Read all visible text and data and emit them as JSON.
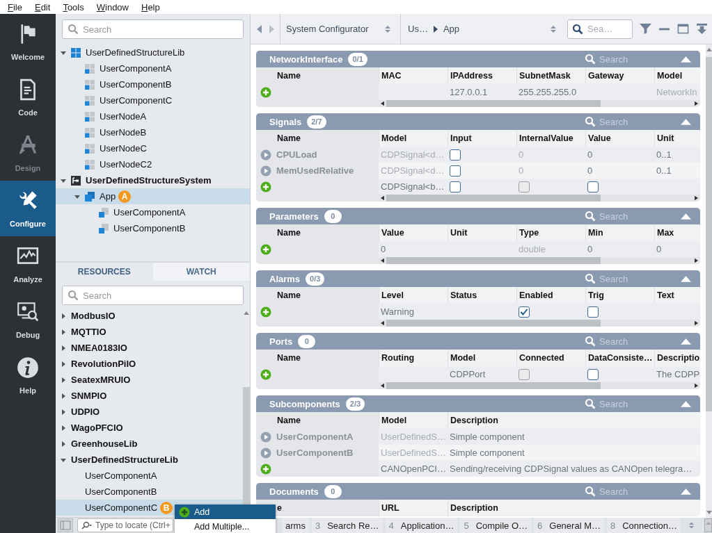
{
  "menu": [
    "File",
    "Edit",
    "Tools",
    "Window",
    "Help"
  ],
  "nav": [
    {
      "label": "Welcome",
      "selected": false,
      "disabled": false
    },
    {
      "label": "Code",
      "selected": false,
      "disabled": false
    },
    {
      "label": "Design",
      "selected": false,
      "disabled": true
    },
    {
      "label": "Configure",
      "selected": true,
      "disabled": false
    },
    {
      "label": "Analyze",
      "selected": false,
      "disabled": false
    },
    {
      "label": "Debug",
      "selected": false,
      "disabled": false
    },
    {
      "label": "Help",
      "selected": false,
      "disabled": false
    }
  ],
  "tree_search": {
    "placeholder": "Search"
  },
  "tree": [
    {
      "label": "UserDefinedStructureLib",
      "kind": "library",
      "expanded": true,
      "selected": false,
      "children": [
        {
          "label": "UserComponentA",
          "kind": "component",
          "selected": false
        },
        {
          "label": "UserComponentB",
          "kind": "component",
          "selected": false
        },
        {
          "label": "UserComponentC",
          "kind": "component",
          "selected": false
        },
        {
          "label": "UserNodeA",
          "kind": "component",
          "selected": false
        },
        {
          "label": "UserNodeB",
          "kind": "component",
          "selected": false
        },
        {
          "label": "UserNodeC",
          "kind": "component",
          "selected": false
        },
        {
          "label": "UserNodeC2",
          "kind": "component",
          "selected": false
        }
      ]
    },
    {
      "label": "UserDefinedStructureSystem",
      "kind": "system",
      "expanded": true,
      "selected": false,
      "children": [
        {
          "label": "App",
          "kind": "app",
          "expanded": true,
          "selected": true,
          "badge": "A",
          "children": [
            {
              "label": "UserComponentA",
              "kind": "instance",
              "selected": false
            },
            {
              "label": "UserComponentB",
              "kind": "instance",
              "selected": false
            }
          ]
        }
      ]
    }
  ],
  "resources_panel": {
    "tabs": [
      {
        "label": "RESOURCES",
        "selected": true
      },
      {
        "label": "WATCH",
        "selected": false
      }
    ],
    "search": {
      "placeholder": "Search"
    },
    "items": [
      {
        "label": "ModbusIO",
        "expanded": false,
        "selected": false
      },
      {
        "label": "MQTTIO",
        "expanded": false,
        "selected": false
      },
      {
        "label": "NMEA0183IO",
        "expanded": false,
        "selected": false
      },
      {
        "label": "RevolutionPiIO",
        "expanded": false,
        "selected": false
      },
      {
        "label": "SeatexMRUIO",
        "expanded": false,
        "selected": false
      },
      {
        "label": "SNMPIO",
        "expanded": false,
        "selected": false
      },
      {
        "label": "UDPIO",
        "expanded": false,
        "selected": false
      },
      {
        "label": "WagoPFCIO",
        "expanded": false,
        "selected": false
      },
      {
        "label": "GreenhouseLib",
        "expanded": false,
        "selected": false
      },
      {
        "label": "UserDefinedStructureLib",
        "expanded": true,
        "selected": false,
        "children": [
          {
            "label": "UserComponentA",
            "selected": false
          },
          {
            "label": "UserComponentB",
            "selected": false
          },
          {
            "label": "UserComponentC",
            "selected": true,
            "badge": "B"
          }
        ]
      }
    ],
    "locate": {
      "placeholder": "Type to locate (Ctrl+"
    }
  },
  "toolbar": {
    "configurator": "System Configurator",
    "breadcrumb": [
      "Us…",
      "App"
    ],
    "search": {
      "placeholder": "Sea…"
    }
  },
  "sections": [
    {
      "title": "NetworkInterface",
      "count": "0/1",
      "search": {
        "placeholder": "Search"
      },
      "columns": [
        "Name",
        "MAC",
        "IPAddress",
        "SubnetMask",
        "Gateway",
        "Model"
      ],
      "rows": [
        {
          "cells": [
            {
              "kind": "add"
            },
            "",
            {
              "kind": "text",
              "text": "127.0.0.1",
              "dim": false
            },
            {
              "kind": "text",
              "text": "255.255.255.0",
              "dim": false
            },
            "",
            {
              "kind": "text",
              "text": "NetworkIn",
              "dim": true
            }
          ]
        }
      ]
    },
    {
      "title": "Signals",
      "count": "2/7",
      "search": {
        "placeholder": "Search"
      },
      "columns": [
        "Name",
        "Model",
        "Input",
        "InternalValue",
        "Value",
        "Unit"
      ],
      "rows": [
        {
          "cells": [
            {
              "kind": "item",
              "text": "CPULoad"
            },
            {
              "kind": "text",
              "text": "CDPSignal<d…",
              "dim": true
            },
            {
              "kind": "checkbox",
              "checked": false,
              "disabled": false
            },
            {
              "kind": "text",
              "text": "0",
              "dim": true
            },
            {
              "kind": "text",
              "text": "0",
              "dim": false
            },
            {
              "kind": "text",
              "text": "0..1",
              "dim": false
            }
          ]
        },
        {
          "cells": [
            {
              "kind": "item",
              "text": "MemUsedRelative"
            },
            {
              "kind": "text",
              "text": "CDPSignal<d…",
              "dim": true
            },
            {
              "kind": "checkbox",
              "checked": false,
              "disabled": false
            },
            {
              "kind": "text",
              "text": "0",
              "dim": true
            },
            {
              "kind": "text",
              "text": "0",
              "dim": false
            },
            {
              "kind": "text",
              "text": "0..1",
              "dim": false
            }
          ]
        },
        {
          "cells": [
            {
              "kind": "add"
            },
            {
              "kind": "text",
              "text": "CDPSignal<b…",
              "dim": false
            },
            {
              "kind": "checkbox",
              "checked": false,
              "disabled": false
            },
            {
              "kind": "checkbox",
              "checked": false,
              "disabled": true
            },
            {
              "kind": "checkbox",
              "checked": false,
              "disabled": false
            },
            ""
          ]
        }
      ]
    },
    {
      "title": "Parameters",
      "count": "0",
      "search": {
        "placeholder": "Search"
      },
      "columns": [
        "Name",
        "Value",
        "Unit",
        "Type",
        "Min",
        "Max"
      ],
      "rows": [
        {
          "cells": [
            {
              "kind": "add"
            },
            {
              "kind": "text",
              "text": "0",
              "dim": false
            },
            "",
            {
              "kind": "text",
              "text": "double",
              "dim": true
            },
            {
              "kind": "text",
              "text": "0",
              "dim": false
            },
            {
              "kind": "text",
              "text": "0",
              "dim": false
            }
          ]
        }
      ]
    },
    {
      "title": "Alarms",
      "count": "0/3",
      "search": {
        "placeholder": "Search"
      },
      "columns": [
        "Name",
        "Level",
        "Status",
        "Enabled",
        "Trig",
        "Text"
      ],
      "rows": [
        {
          "cells": [
            {
              "kind": "add"
            },
            {
              "kind": "text",
              "text": "Warning",
              "dim": false
            },
            "",
            {
              "kind": "checkbox",
              "checked": true,
              "disabled": false
            },
            {
              "kind": "checkbox",
              "checked": false,
              "disabled": false
            },
            ""
          ]
        }
      ]
    },
    {
      "title": "Ports",
      "count": "0",
      "search": {
        "placeholder": "Search"
      },
      "columns": [
        "Name",
        "Routing",
        "Model",
        "Connected",
        "DataConsiste…",
        "Descriptio"
      ],
      "rows": [
        {
          "cells": [
            {
              "kind": "add"
            },
            "",
            {
              "kind": "text",
              "text": "CDPPort",
              "dim": false
            },
            {
              "kind": "checkbox",
              "checked": false,
              "disabled": true
            },
            {
              "kind": "checkbox",
              "checked": false,
              "disabled": false
            },
            {
              "kind": "text",
              "text": "The CDPP",
              "dim": false
            }
          ]
        }
      ]
    },
    {
      "title": "Subcomponents",
      "count": "2/3",
      "search": {
        "placeholder": "Search"
      },
      "columns": [
        "Name",
        "Model",
        "Description"
      ],
      "rows": [
        {
          "cells": [
            {
              "kind": "item",
              "text": "UserComponentA"
            },
            {
              "kind": "text",
              "text": "UserDefinedS…",
              "dim": true
            },
            {
              "kind": "text",
              "text": "Simple component",
              "dim": false
            }
          ]
        },
        {
          "cells": [
            {
              "kind": "item",
              "text": "UserComponentB"
            },
            {
              "kind": "text",
              "text": "UserDefinedS…",
              "dim": true
            },
            {
              "kind": "text",
              "text": "Simple component",
              "dim": false
            }
          ]
        },
        {
          "cells": [
            {
              "kind": "add"
            },
            {
              "kind": "text",
              "text": "CANOpenPCI…",
              "dim": false
            },
            {
              "kind": "text",
              "text": "Sending/receiving CDPSignal values as CANOpen telegra…",
              "dim": false
            }
          ]
        }
      ]
    },
    {
      "title": "Documents",
      "count": "0",
      "search": {
        "placeholder": "Search"
      },
      "columns": [
        "e",
        "URL",
        "Description"
      ]
    }
  ],
  "output_tabs": [
    {
      "label": "arms"
    },
    {
      "number": "3",
      "label": "Search Re…"
    },
    {
      "number": "4",
      "label": "Application…"
    },
    {
      "number": "5",
      "label": "Compile O…"
    },
    {
      "number": "6",
      "label": "General M…"
    },
    {
      "number": "8",
      "label": "Connection…"
    }
  ],
  "context_menu": [
    {
      "kind": "add",
      "label": "Add",
      "selected": true
    },
    {
      "kind": "plain",
      "label": "Add Multiple...",
      "selected": false
    }
  ]
}
